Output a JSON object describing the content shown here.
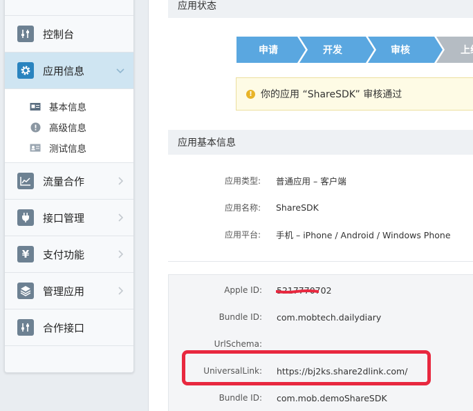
{
  "sidebar": {
    "items": [
      {
        "label": "控制台"
      },
      {
        "label": "应用信息"
      },
      {
        "label": "流量合作"
      },
      {
        "label": "接口管理"
      },
      {
        "label": "支付功能"
      },
      {
        "label": "管理应用"
      },
      {
        "label": "合作接口"
      }
    ],
    "subitems": [
      {
        "label": "基本信息"
      },
      {
        "label": "高级信息"
      },
      {
        "label": "测试信息"
      }
    ]
  },
  "status_section": {
    "title": "应用状态",
    "steps": [
      "申请",
      "开发",
      "审核",
      "上线"
    ],
    "notice": "你的应用 “ShareSDK” 审核通过"
  },
  "basic_section": {
    "title": "应用基本信息",
    "rows": [
      {
        "key": "应用类型:",
        "value": "普通应用  –  客户端"
      },
      {
        "key": "应用名称:",
        "value": "ShareSDK"
      },
      {
        "key": "应用平台:",
        "value": "手机  –  iPhone / Android / Windows Phone"
      }
    ]
  },
  "dev_section": {
    "rows": [
      {
        "key": "Apple ID:",
        "value": "5217770702"
      },
      {
        "key": "Bundle ID:",
        "value": "com.mobtech.dailydiary"
      },
      {
        "key": "UrlSchema:",
        "value": ""
      },
      {
        "key": "UniversalLink:",
        "value": "https://bj2ks.share2dlink.com/"
      },
      {
        "key": "Bundle ID:",
        "value": "com.mob.demoShareSDK"
      }
    ]
  },
  "colors": {
    "accent": "#2a84bf",
    "step_active": "#5aa7e0",
    "step_inactive": "#b5bcc3",
    "highlight": "#e8283f"
  }
}
